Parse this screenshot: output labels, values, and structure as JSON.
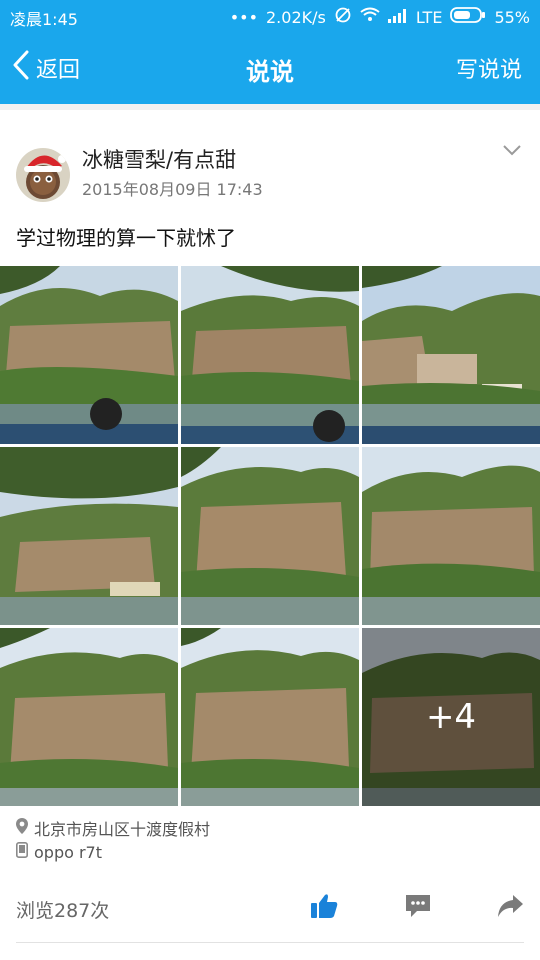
{
  "status_bar": {
    "time": "凌晨1:45",
    "dots": "•••",
    "speed": "2.02K/s",
    "network": "LTE",
    "battery": "55%"
  },
  "nav": {
    "back_label": "返回",
    "title": "说说",
    "right_action": "写说说"
  },
  "post": {
    "username": "冰糖雪梨/有点甜",
    "timestamp": "2015年08月09日 17:43",
    "text": "学过物理的算一下就怵了",
    "more_count": "+4",
    "location": "北京市房山区十渡度假村",
    "device": "oppo r7t",
    "views": "浏览287次"
  },
  "icons": {
    "back": "back-chevron-icon",
    "menu": "chevron-down-icon",
    "location": "location-pin-icon",
    "device": "phone-icon",
    "like": "thumbs-up-icon",
    "comment": "comment-icon",
    "share": "share-arrow-icon"
  },
  "colors": {
    "accent": "#1aa7ec",
    "like": "#1a82d9",
    "icon_gray": "#7a7a7a"
  }
}
